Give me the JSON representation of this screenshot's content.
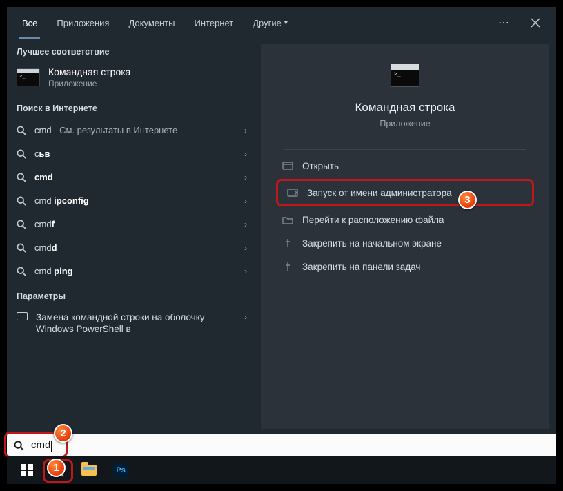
{
  "tabs": {
    "all": "Все",
    "apps": "Приложения",
    "docs": "Документы",
    "internet": "Интернет",
    "other": "Другие"
  },
  "groups": {
    "best": "Лучшее соответствие",
    "web": "Поиск в Интернете",
    "params": "Параметры"
  },
  "best_match": {
    "title": "Командная строка",
    "subtitle": "Приложение"
  },
  "web_results": [
    {
      "prefix": "cmd",
      "suffix": " - См. результаты в Интернете"
    },
    {
      "prefix": "с",
      "bold_tail": "ьв"
    },
    {
      "prefix": "cmd",
      "bold_tail": ""
    },
    {
      "prefix": "cmd ",
      "bold_tail": "ipconfig"
    },
    {
      "prefix": "cmd",
      "bold_tail": "f"
    },
    {
      "prefix": "cmd",
      "bold_tail": "d"
    },
    {
      "prefix": "cmd ",
      "bold_tail": "ping"
    }
  ],
  "param_item": "Замена командной строки на оболочку Windows PowerShell в",
  "preview": {
    "title": "Командная строка",
    "subtitle": "Приложение"
  },
  "actions": {
    "open": "Открыть",
    "admin": "Запуск от имени администратора",
    "goto": "Перейти к расположению файла",
    "pin_start": "Закрепить на начальном экране",
    "pin_taskbar": "Закрепить на панели задач"
  },
  "search": {
    "value": "cmd"
  },
  "callouts": {
    "one": "1",
    "two": "2",
    "three": "3"
  },
  "taskbar": {
    "ps": "Ps"
  }
}
